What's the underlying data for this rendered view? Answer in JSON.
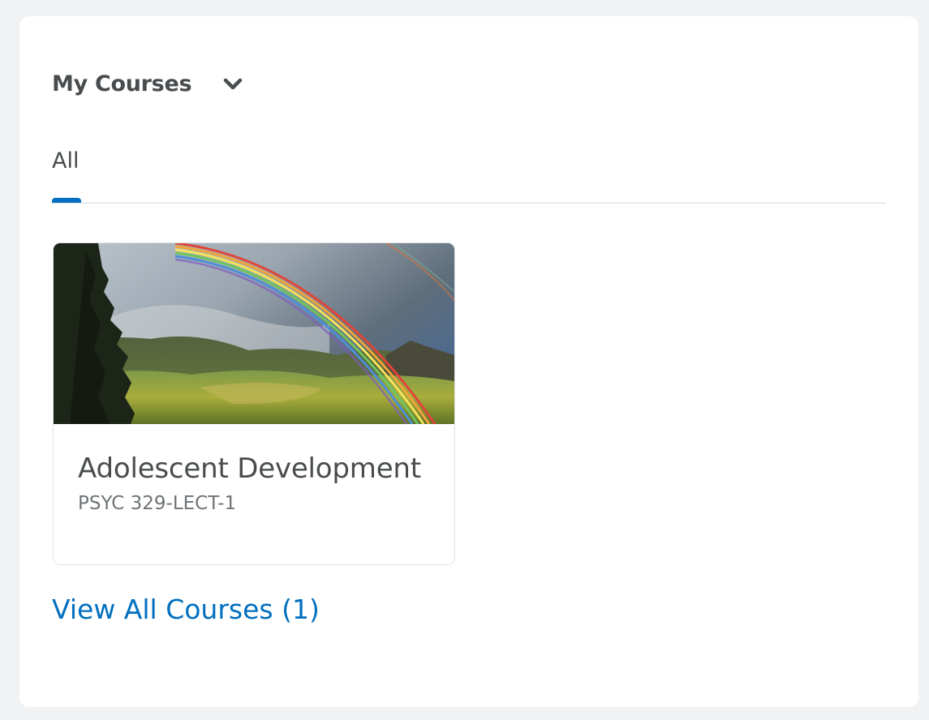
{
  "widget": {
    "title": "My Courses",
    "dropdown_icon": "chevron-down-icon"
  },
  "tabs": [
    {
      "label": "All",
      "selected": true
    }
  ],
  "courses": [
    {
      "name": "Adolescent Development",
      "code": "PSYC 329-LECT-1",
      "image": "rainbow-over-mountains-image"
    }
  ],
  "view_all": {
    "label": "View All Courses (1)"
  },
  "colors": {
    "accent": "#006fbf",
    "text": "#494c4e",
    "muted_text": "#6e7376",
    "background": "#f1f2f4",
    "card_border": "#dfe3e8"
  }
}
